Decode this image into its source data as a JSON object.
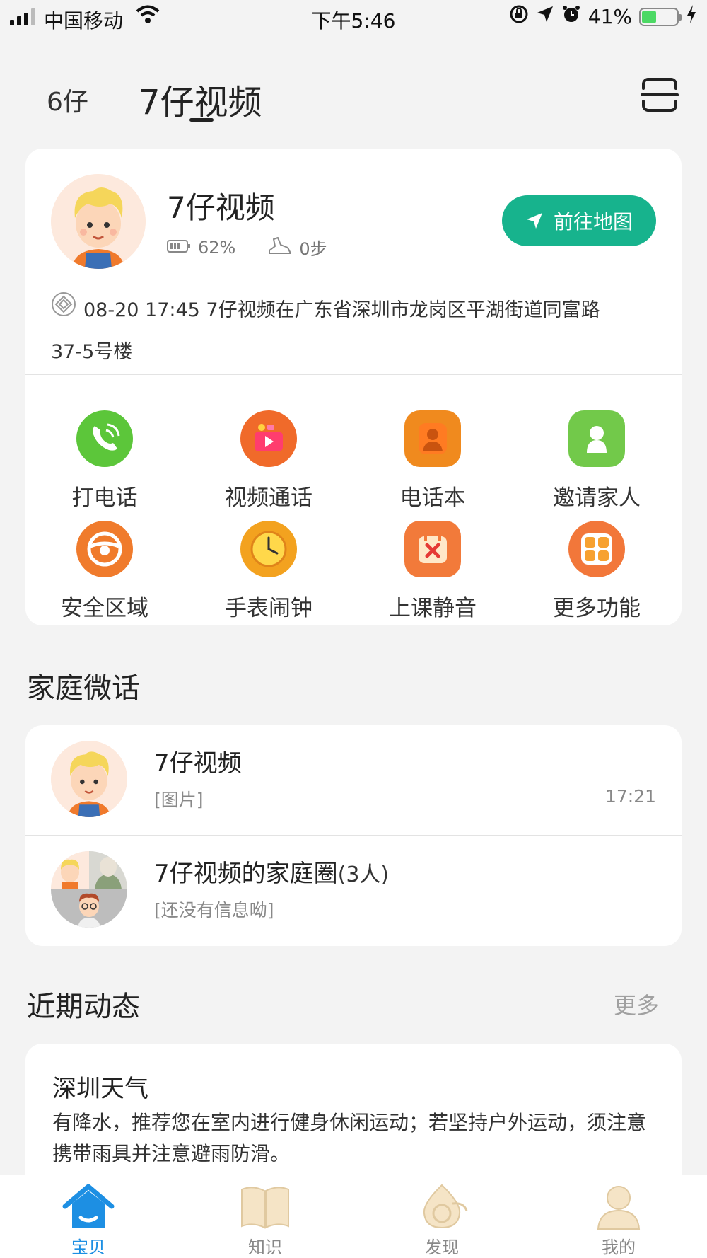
{
  "status_bar": {
    "carrier": "中国移动",
    "time": "下午5:46",
    "battery_percent": "41%",
    "battery_level": 0.41
  },
  "header": {
    "tab_other": "6仔",
    "tab_active": "7仔视频"
  },
  "profile": {
    "name": "7仔视频",
    "battery": "62%",
    "steps": "0步",
    "map_button": "前往地图",
    "location_line1": "08-20 17:45 7仔视频在广东省深圳市龙岗区平湖街道同富路",
    "location_line2": "37-5号楼"
  },
  "features": [
    {
      "label": "打电话",
      "icon": "phone-icon",
      "color": "#5cc63a"
    },
    {
      "label": "视频通话",
      "icon": "video-call-icon",
      "color": "#f06a2a"
    },
    {
      "label": "电话本",
      "icon": "contacts-icon",
      "color": "#f08a1e"
    },
    {
      "label": "邀请家人",
      "icon": "invite-family-icon",
      "color": "#72c94a"
    },
    {
      "label": "安全区域",
      "icon": "safe-zone-icon",
      "color": "#f07b2c"
    },
    {
      "label": "手表闹钟",
      "icon": "alarm-clock-icon",
      "color": "#f3a21f"
    },
    {
      "label": "上课静音",
      "icon": "class-mute-icon",
      "color": "#f27a3a"
    },
    {
      "label": "更多功能",
      "icon": "more-functions-icon",
      "color": "#f2773a"
    }
  ],
  "family_chat": {
    "title": "家庭微话",
    "items": [
      {
        "title": "7仔视频",
        "sub": "[图片]",
        "time": "17:21"
      },
      {
        "title": "7仔视频的家庭圈",
        "count": "(3人)",
        "sub": "[还没有信息呦]"
      }
    ]
  },
  "recent": {
    "title": "近期动态",
    "more": "更多",
    "news_title": "深圳天气",
    "news_body": "有降水，推荐您在室内进行健身休闲运动；若坚持户外运动，须注意携带雨具并注意避雨防滑。"
  },
  "bottom_nav": [
    {
      "label": "宝贝",
      "icon": "home-icon",
      "active": true
    },
    {
      "label": "知识",
      "icon": "book-icon",
      "active": false
    },
    {
      "label": "发现",
      "icon": "discover-icon",
      "active": false
    },
    {
      "label": "我的",
      "icon": "profile-icon",
      "active": false
    }
  ],
  "colors": {
    "accent_green": "#17b38d",
    "nav_active_blue": "#1d8fe3",
    "background": "#f3f3f3"
  }
}
